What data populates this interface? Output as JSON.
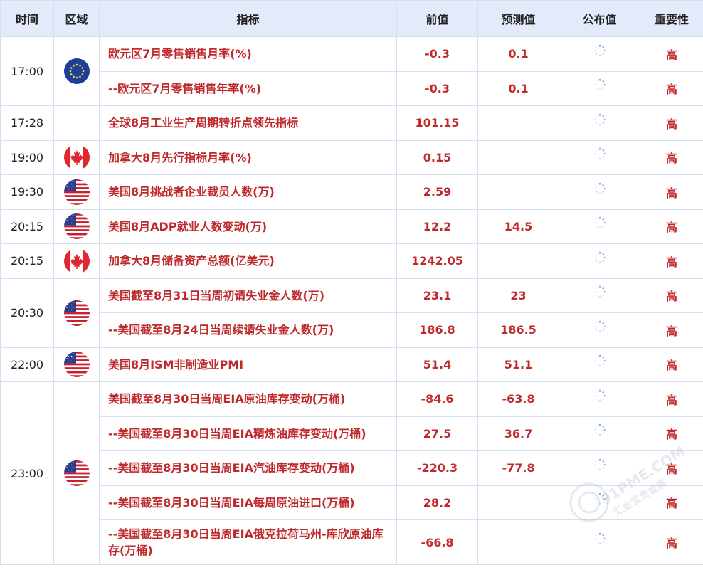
{
  "header": {
    "time": "时间",
    "region": "区域",
    "indicator": "指标",
    "previous": "前值",
    "forecast": "预测值",
    "actual": "公布值",
    "importance": "重要性"
  },
  "rows": [
    {
      "time": "17:00",
      "region_icon": "eu-flag-icon",
      "indicator": "欧元区7月零售销售月率(%)",
      "previous": "-0.3",
      "forecast": "0.1",
      "importance": "高"
    },
    {
      "indicator": "--欧元区7月零售销售年率(%)",
      "previous": "-0.3",
      "forecast": "0.1",
      "importance": "高"
    },
    {
      "time": "17:28",
      "region_icon": "",
      "indicator": "全球8月工业生产周期转折点领先指标",
      "previous": "101.15",
      "forecast": "",
      "importance": "高"
    },
    {
      "time": "19:00",
      "region_icon": "canada-flag-icon",
      "indicator": "加拿大8月先行指标月率(%)",
      "previous": "0.15",
      "forecast": "",
      "importance": "高"
    },
    {
      "time": "19:30",
      "region_icon": "us-flag-icon",
      "indicator": "美国8月挑战者企业裁员人数(万)",
      "previous": "2.59",
      "forecast": "",
      "importance": "高"
    },
    {
      "time": "20:15",
      "region_icon": "us-flag-icon",
      "indicator": "美国8月ADP就业人数变动(万)",
      "previous": "12.2",
      "forecast": "14.5",
      "importance": "高"
    },
    {
      "time": "20:15",
      "region_icon": "canada-flag-icon",
      "indicator": "加拿大8月储备资产总额(亿美元)",
      "previous": "1242.05",
      "forecast": "",
      "importance": "高"
    },
    {
      "time": "20:30",
      "region_icon": "us-flag-icon",
      "indicator": "美国截至8月31日当周初请失业金人数(万)",
      "previous": "23.1",
      "forecast": "23",
      "importance": "高"
    },
    {
      "indicator": "--美国截至8月24日当周续请失业金人数(万)",
      "previous": "186.8",
      "forecast": "186.5",
      "importance": "高"
    },
    {
      "time": "22:00",
      "region_icon": "us-flag-icon",
      "indicator": "美国8月ISM非制造业PMI",
      "previous": "51.4",
      "forecast": "51.1",
      "importance": "高"
    },
    {
      "time": "23:00",
      "region_icon": "us-flag-icon",
      "indicator": "美国截至8月30日当周EIA原油库存变动(万桶)",
      "previous": "-84.6",
      "forecast": "-63.8",
      "importance": "高"
    },
    {
      "indicator": "--美国截至8月30日当周EIA精炼油库存变动(万桶)",
      "previous": "27.5",
      "forecast": "36.7",
      "importance": "高"
    },
    {
      "indicator": "--美国截至8月30日当周EIA汽油库存变动(万桶)",
      "previous": "-220.3",
      "forecast": "-77.8",
      "importance": "高"
    },
    {
      "indicator": "--美国截至8月30日当周EIA每周原油进口(万桶)",
      "previous": "28.2",
      "forecast": "",
      "importance": "高"
    },
    {
      "indicator": "--美国截至8月30日当周EIA俄克拉荷马州-库欣原油库存(万桶)",
      "previous": "-66.8",
      "forecast": "",
      "importance": "高"
    }
  ],
  "actual_icon": "loading-spinner-icon",
  "watermark": "91PME.COM 汇金宝贵金属",
  "colors": {
    "accent": "#c0292b",
    "header_bg": "#e3ebfb",
    "border": "#d6def2"
  }
}
